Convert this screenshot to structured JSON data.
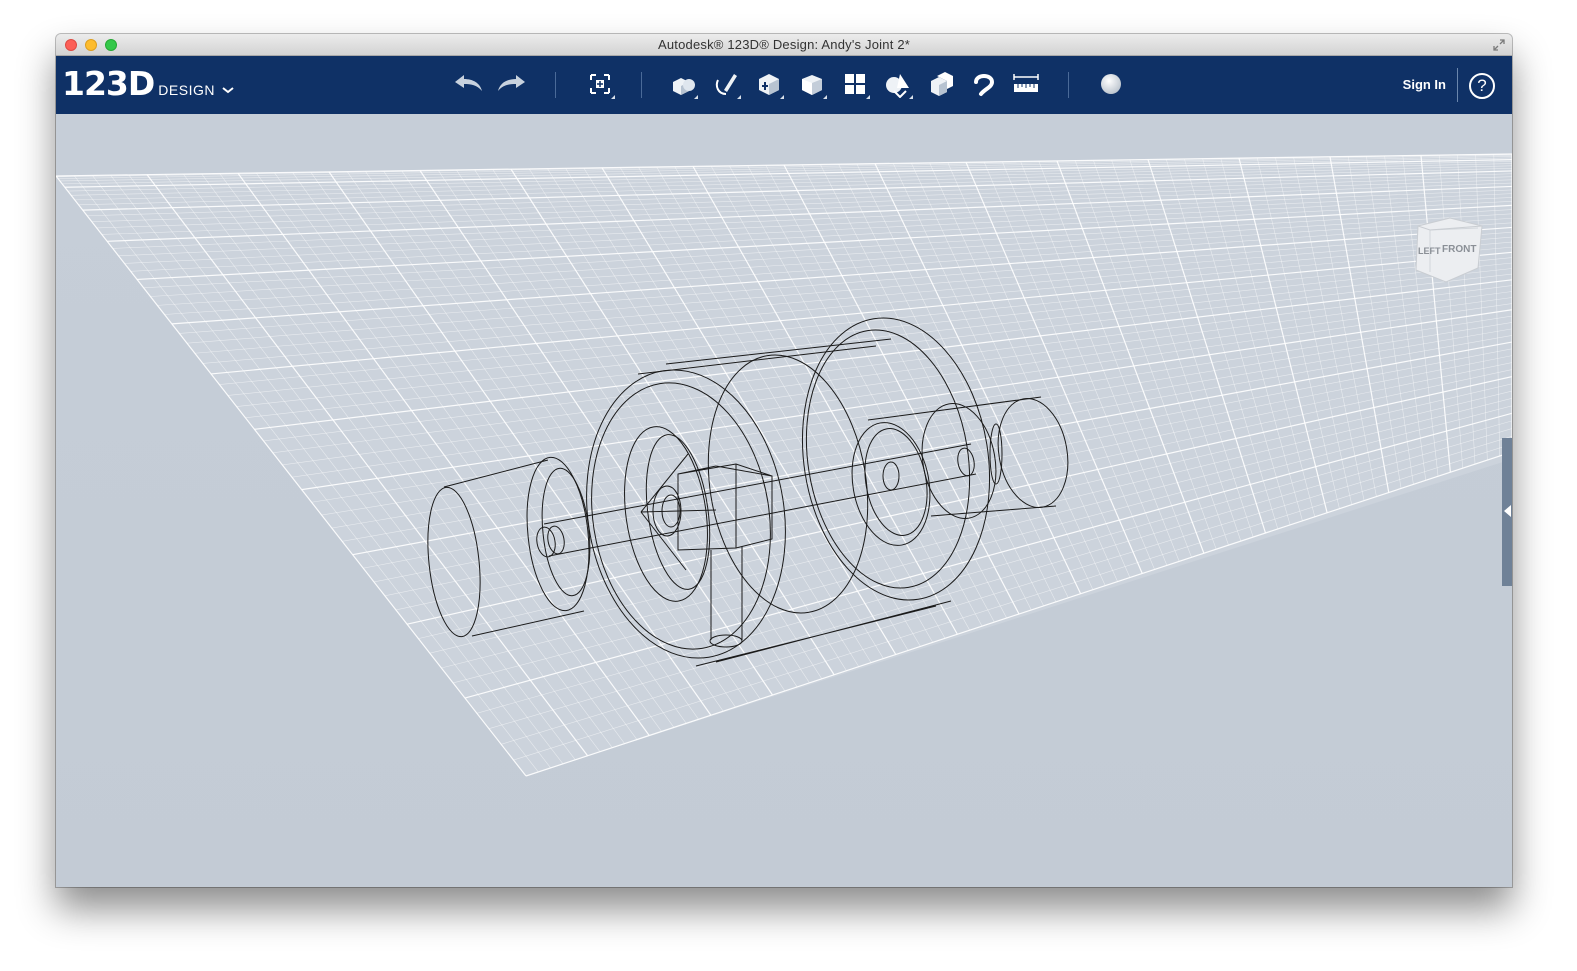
{
  "window": {
    "title": "Autodesk® 123D® Design: Andy's Joint 2*"
  },
  "app": {
    "logo_number": "123D",
    "logo_word": "DESIGN"
  },
  "toolbar": {
    "tools": [
      {
        "name": "undo",
        "icon": "undo-arrow-icon"
      },
      {
        "name": "redo",
        "icon": "redo-arrow-icon"
      },
      {
        "name": "transform",
        "icon": "transform-icon"
      },
      {
        "name": "primitives",
        "icon": "primitives-icon"
      },
      {
        "name": "sketch",
        "icon": "sketch-icon"
      },
      {
        "name": "construct",
        "icon": "construct-icon"
      },
      {
        "name": "modify",
        "icon": "modify-icon"
      },
      {
        "name": "pattern",
        "icon": "pattern-icon"
      },
      {
        "name": "grouping",
        "icon": "grouping-icon"
      },
      {
        "name": "combine",
        "icon": "combine-icon"
      },
      {
        "name": "snap",
        "icon": "snap-icon"
      },
      {
        "name": "measure",
        "icon": "measure-icon"
      },
      {
        "name": "material",
        "icon": "material-sphere-icon"
      }
    ],
    "sign_in_label": "Sign In",
    "help_label": "?"
  },
  "viewcube": {
    "left_label": "LEFT",
    "front_label": "FRONT"
  },
  "colors": {
    "toolbar_bg": "#0f3166",
    "viewport_bg": "#c6ced8",
    "grid_line": "#ffffff",
    "wireframe": "#1a1a1a"
  }
}
